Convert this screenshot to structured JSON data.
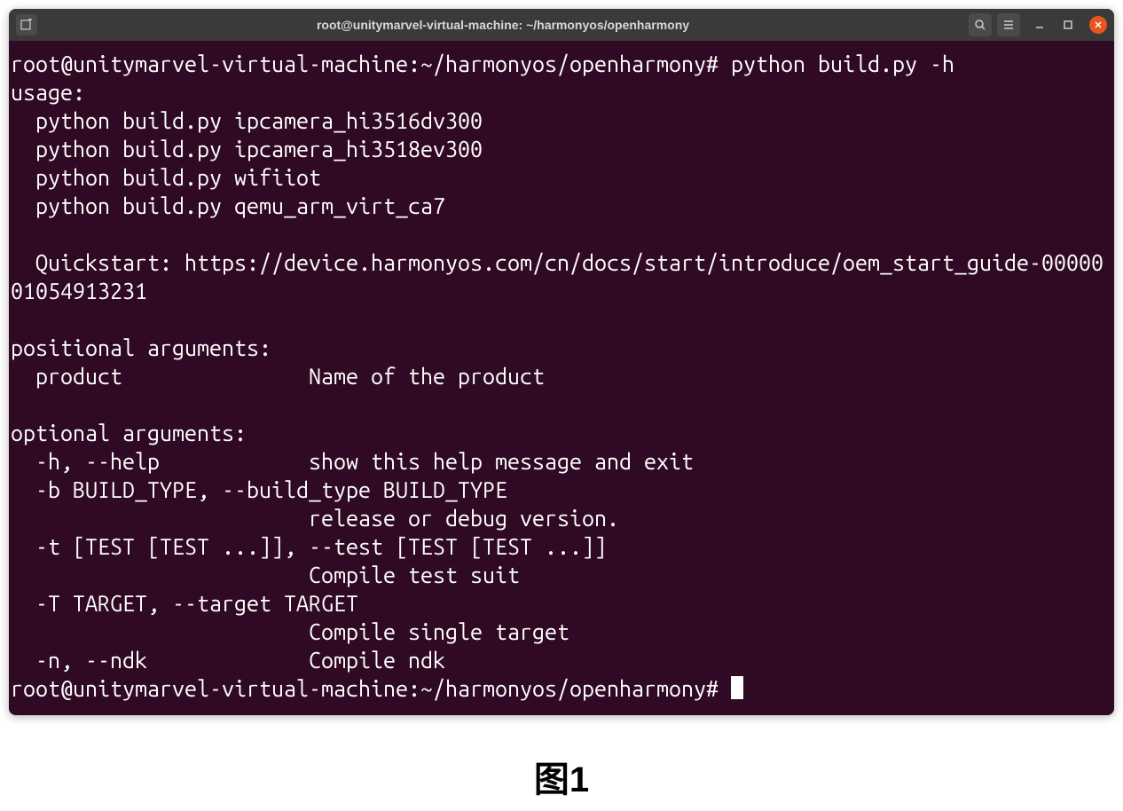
{
  "titlebar": {
    "title": "root@unitymarvel-virtual-machine: ~/harmonyos/openharmony"
  },
  "prompt": {
    "full": "root@unitymarvel-virtual-machine:~/harmonyos/openharmony#"
  },
  "command": "python build.py -h",
  "output": {
    "usage_label": "usage:",
    "usage_lines": [
      "  python build.py ipcamera_hi3516dv300",
      "  python build.py ipcamera_hi3518ev300",
      "  python build.py wifiiot",
      "  python build.py qemu_arm_virt_ca7"
    ],
    "quickstart": "  Quickstart: https://device.harmonyos.com/cn/docs/start/introduce/oem_start_guide-0000001054913231",
    "positional_header": "positional arguments:",
    "positional_line": "  product               Name of the product",
    "optional_header": "optional arguments:",
    "optional_lines": [
      "  -h, --help            show this help message and exit",
      "  -b BUILD_TYPE, --build_type BUILD_TYPE",
      "                        release or debug version.",
      "  -t [TEST [TEST ...]], --test [TEST [TEST ...]]",
      "                        Compile test suit",
      "  -T TARGET, --target TARGET",
      "                        Compile single target",
      "  -n, --ndk             Compile ndk"
    ]
  },
  "caption": "图1"
}
